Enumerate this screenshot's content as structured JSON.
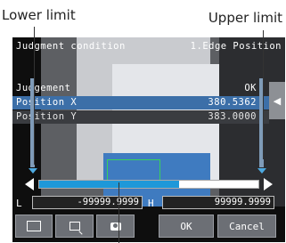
{
  "annotations": {
    "lower_limit": "Lower limit",
    "upper_limit": "Upper limit"
  },
  "header": {
    "title": "Judgment condition",
    "item": "1.Edge Position"
  },
  "results": [
    {
      "label": "Judgement",
      "value": "OK"
    },
    {
      "label": "Position X",
      "value": "380.5362"
    },
    {
      "label": "Position Y",
      "value": "383.0000"
    }
  ],
  "slider": {
    "fill_fraction": 0.64
  },
  "limits": {
    "lower_label": "L",
    "lower_value": "-99999.9999",
    "upper_label": "H",
    "upper_value": "99999.9999"
  },
  "buttons": {
    "ok": "OK",
    "cancel": "Cancel"
  },
  "icons": [
    "fit-icon",
    "zoom-icon",
    "camera-icon",
    "arrow-left-icon",
    "arrow-right-icon",
    "chevron-left-icon"
  ],
  "colors": {
    "selected_row": "#3c6fa8",
    "slider_fill": "#1e98d9",
    "roi": "#39d15a"
  }
}
